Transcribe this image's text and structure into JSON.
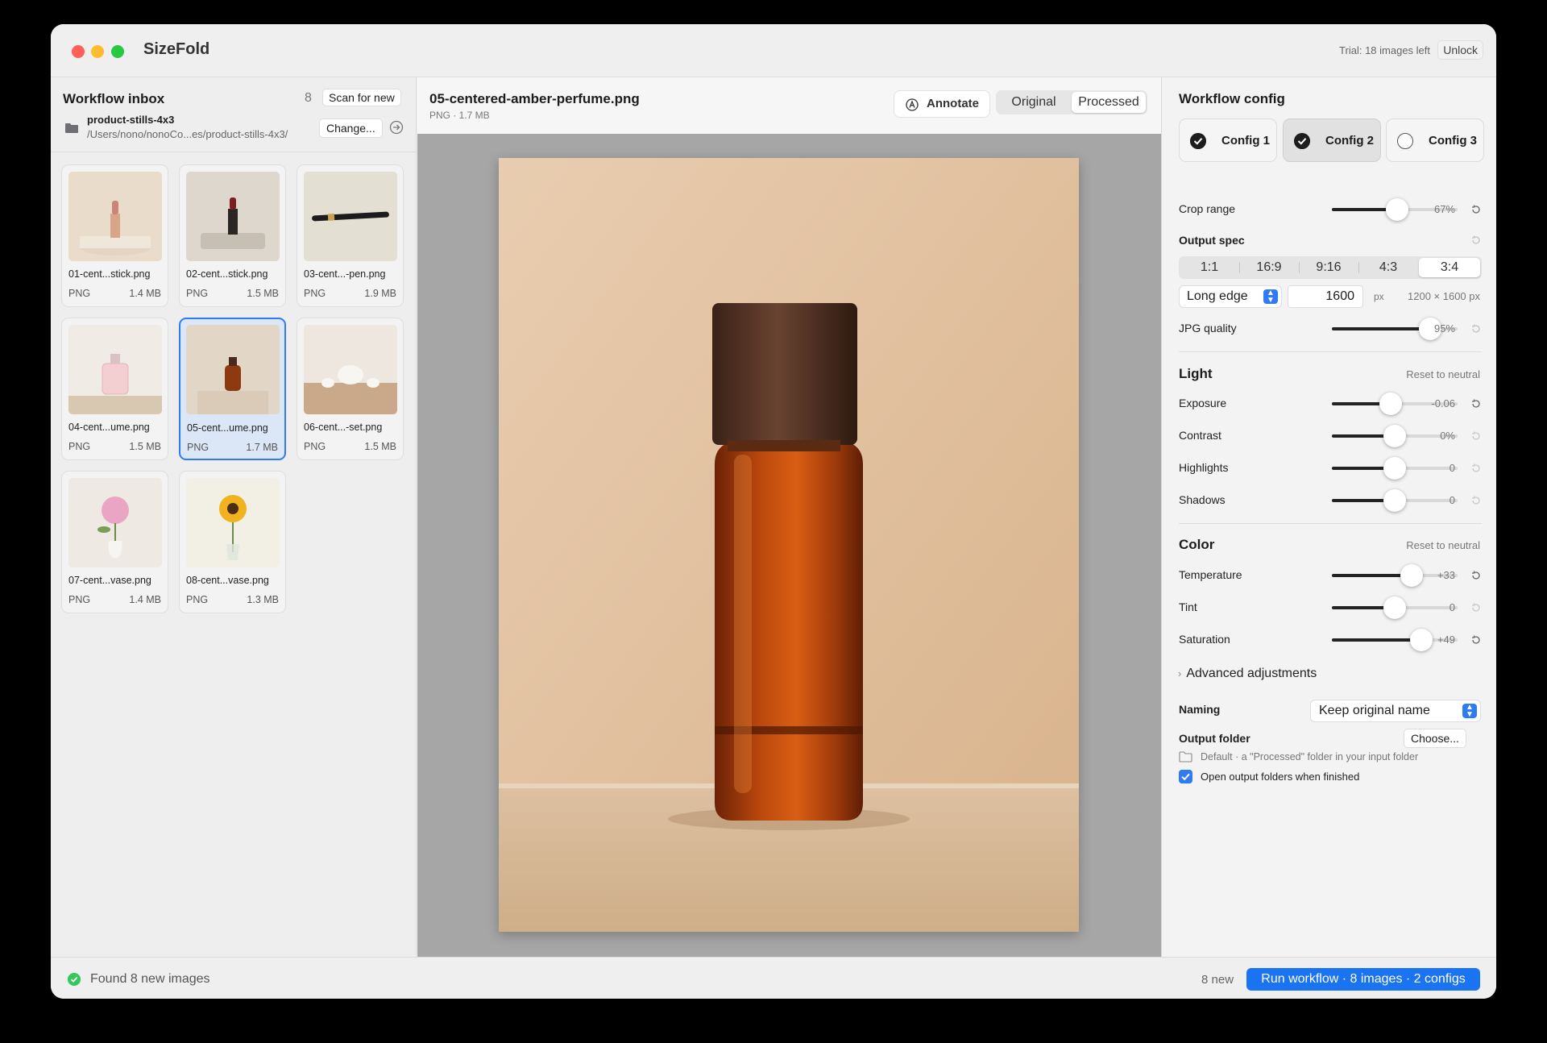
{
  "app": {
    "title": "SizeFold",
    "trial": "Trial: 18 images left",
    "unlock_label": "Unlock"
  },
  "sidebar": {
    "title": "Workflow inbox",
    "count": "8",
    "scan_label": "Scan for new",
    "folder_name": "product-stills-4x3",
    "folder_path": "/Users/nono/nonoCo...es/product-stills-4x3/",
    "change_label": "Change...",
    "items": [
      {
        "name": "01-cent...stick.png",
        "type": "PNG",
        "size": "1.4 MB"
      },
      {
        "name": "02-cent...stick.png",
        "type": "PNG",
        "size": "1.5 MB"
      },
      {
        "name": "03-cent...-pen.png",
        "type": "PNG",
        "size": "1.9 MB"
      },
      {
        "name": "04-cent...ume.png",
        "type": "PNG",
        "size": "1.5 MB"
      },
      {
        "name": "05-cent...ume.png",
        "type": "PNG",
        "size": "1.7 MB"
      },
      {
        "name": "06-cent...-set.png",
        "type": "PNG",
        "size": "1.5 MB"
      },
      {
        "name": "07-cent...vase.png",
        "type": "PNG",
        "size": "1.4 MB"
      },
      {
        "name": "08-cent...vase.png",
        "type": "PNG",
        "size": "1.3 MB"
      }
    ]
  },
  "preview": {
    "file_title": "05-centered-amber-perfume.png",
    "file_meta": "PNG · 1.7 MB",
    "annotate_label": "Annotate",
    "view_original": "Original",
    "view_processed": "Processed",
    "selected_view": "Processed"
  },
  "config": {
    "title": "Workflow config",
    "configs": [
      {
        "label": "Config 1",
        "checked": true,
        "active": false
      },
      {
        "label": "Config 2",
        "checked": true,
        "active": true
      },
      {
        "label": "Config 3",
        "checked": false,
        "active": false
      }
    ],
    "crop_label": "Crop range",
    "crop_value": "67%",
    "crop_fraction": 0.52,
    "output_spec_label": "Output spec",
    "ratios": [
      "1:1",
      "16:9",
      "9:16",
      "4:3",
      "3:4"
    ],
    "selected_ratio": "3:4",
    "edge_mode": "Long edge",
    "edge_value": "1600",
    "edge_unit": "px",
    "dims": "1200 × 1600 px",
    "jpg_label": "JPG quality",
    "jpg_value": "95%",
    "jpg_fraction": 0.78,
    "light": {
      "title": "Light",
      "reset": "Reset to neutral",
      "rows": [
        {
          "label": "Exposure",
          "value": "-0.06",
          "fraction": 0.47
        },
        {
          "label": "Contrast",
          "value": "0%",
          "fraction": 0.5
        },
        {
          "label": "Highlights",
          "value": "0",
          "fraction": 0.5
        },
        {
          "label": "Shadows",
          "value": "0",
          "fraction": 0.5
        }
      ]
    },
    "color": {
      "title": "Color",
      "reset": "Reset to neutral",
      "rows": [
        {
          "label": "Temperature",
          "value": "+33",
          "fraction": 0.635
        },
        {
          "label": "Tint",
          "value": "0",
          "fraction": 0.5
        },
        {
          "label": "Saturation",
          "value": "+49",
          "fraction": 0.71
        }
      ]
    },
    "advanced_label": "Advanced adjustments",
    "naming_label": "Naming",
    "naming_value": "Keep original name",
    "output_folder_label": "Output folder",
    "choose_label": "Choose...",
    "output_folder_desc": "Default · a \"Processed\" folder in your input folder",
    "open_folders_label": "Open output folders when finished",
    "open_folders_checked": true
  },
  "status": {
    "message": "Found 8 new images",
    "new_count": "8 new",
    "run_label": "Run workflow · 8 images · 2 configs"
  }
}
